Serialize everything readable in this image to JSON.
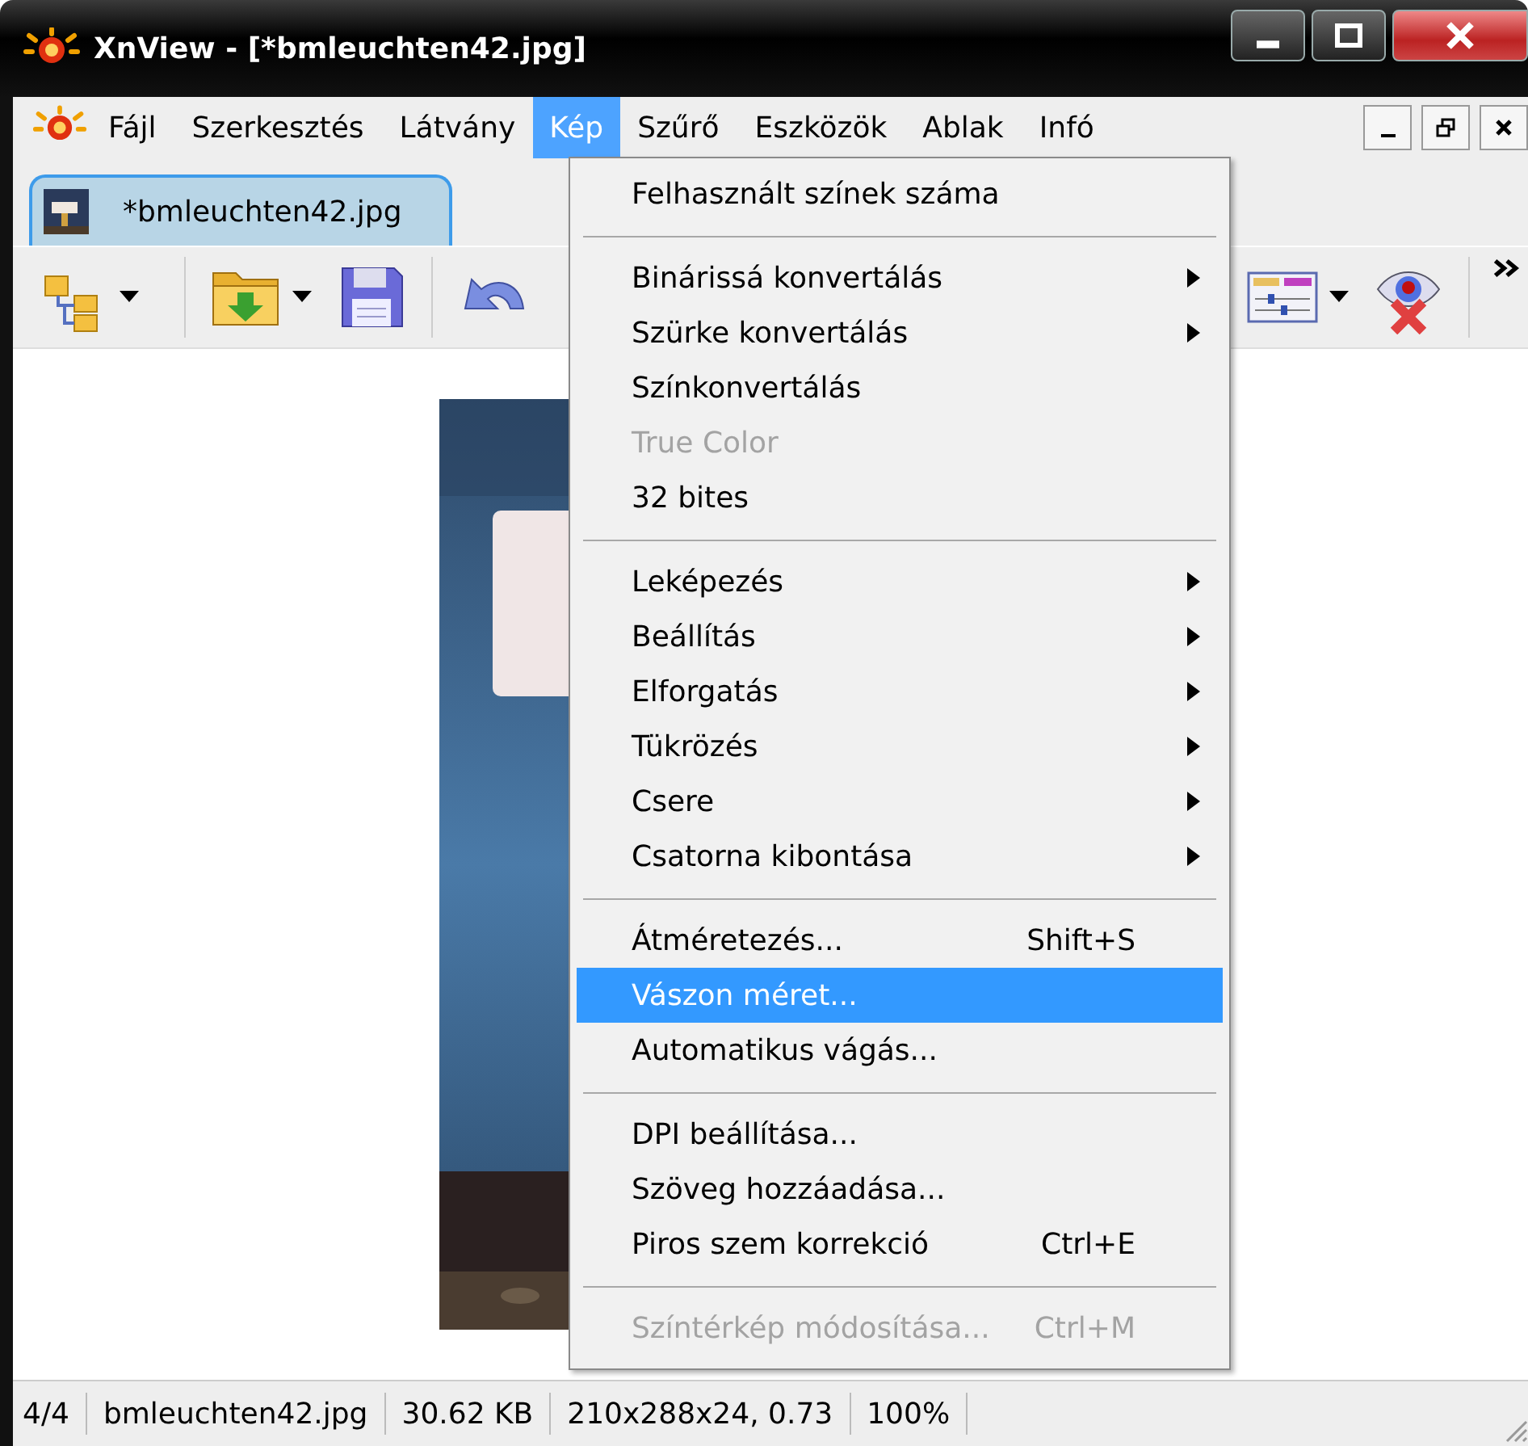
{
  "window": {
    "title": "XnView - [*bmleuchten42.jpg]"
  },
  "menu_bar": {
    "items": [
      {
        "label": "Fájl",
        "selected": false
      },
      {
        "label": "Szerkesztés",
        "selected": false
      },
      {
        "label": "Látvány",
        "selected": false
      },
      {
        "label": "Kép",
        "selected": true
      },
      {
        "label": "Szűrő",
        "selected": false
      },
      {
        "label": "Eszközök",
        "selected": false
      },
      {
        "label": "Ablak",
        "selected": false
      },
      {
        "label": "Infó",
        "selected": false
      }
    ]
  },
  "tabs": [
    {
      "label": "*bmleuchten42.jpg",
      "selected": true
    }
  ],
  "image_menu": {
    "items": [
      {
        "kind": "item",
        "label": "Felhasznált színek száma",
        "submenu": false,
        "disabled": false,
        "selected": false
      },
      {
        "kind": "separator"
      },
      {
        "kind": "item",
        "label": "Binárissá konvertálás",
        "submenu": true,
        "disabled": false,
        "selected": false
      },
      {
        "kind": "item",
        "label": "Szürke konvertálás",
        "submenu": true,
        "disabled": false,
        "selected": false
      },
      {
        "kind": "item",
        "label": "Színkonvertálás",
        "submenu": false,
        "disabled": false,
        "selected": false
      },
      {
        "kind": "item",
        "label": "True Color",
        "submenu": false,
        "disabled": true,
        "selected": false
      },
      {
        "kind": "item",
        "label": "32 bites",
        "submenu": false,
        "disabled": false,
        "selected": false
      },
      {
        "kind": "separator"
      },
      {
        "kind": "item",
        "label": "Leképezés",
        "submenu": true,
        "disabled": false,
        "selected": false
      },
      {
        "kind": "item",
        "label": "Beállítás",
        "submenu": true,
        "disabled": false,
        "selected": false
      },
      {
        "kind": "item",
        "label": "Elforgatás",
        "submenu": true,
        "disabled": false,
        "selected": false
      },
      {
        "kind": "item",
        "label": "Tükrözés",
        "submenu": true,
        "disabled": false,
        "selected": false
      },
      {
        "kind": "item",
        "label": "Csere",
        "submenu": true,
        "disabled": false,
        "selected": false
      },
      {
        "kind": "item",
        "label": "Csatorna kibontása",
        "submenu": true,
        "disabled": false,
        "selected": false
      },
      {
        "kind": "separator"
      },
      {
        "kind": "item",
        "label": "Átméretezés...",
        "shortcut": "Shift+S",
        "submenu": false,
        "disabled": false,
        "selected": false
      },
      {
        "kind": "item",
        "label": "Vászon méret...",
        "submenu": false,
        "disabled": false,
        "selected": true
      },
      {
        "kind": "item",
        "label": "Automatikus vágás...",
        "submenu": false,
        "disabled": false,
        "selected": false
      },
      {
        "kind": "separator"
      },
      {
        "kind": "item",
        "label": "DPI beállítása...",
        "submenu": false,
        "disabled": false,
        "selected": false
      },
      {
        "kind": "item",
        "label": "Szöveg hozzáadása...",
        "submenu": false,
        "disabled": false,
        "selected": false
      },
      {
        "kind": "item",
        "label": "Piros szem korrekció",
        "shortcut": "Ctrl+E",
        "submenu": false,
        "disabled": false,
        "selected": false
      },
      {
        "kind": "separator"
      },
      {
        "kind": "item",
        "label": "Színtérkép módosítása...",
        "shortcut": "Ctrl+M",
        "submenu": false,
        "disabled": true,
        "selected": false
      }
    ]
  },
  "status_bar": {
    "fields": [
      "4/4",
      "bmleuchten42.jpg",
      "30.62 KB",
      "210x288x24, 0.73",
      "100%"
    ]
  }
}
